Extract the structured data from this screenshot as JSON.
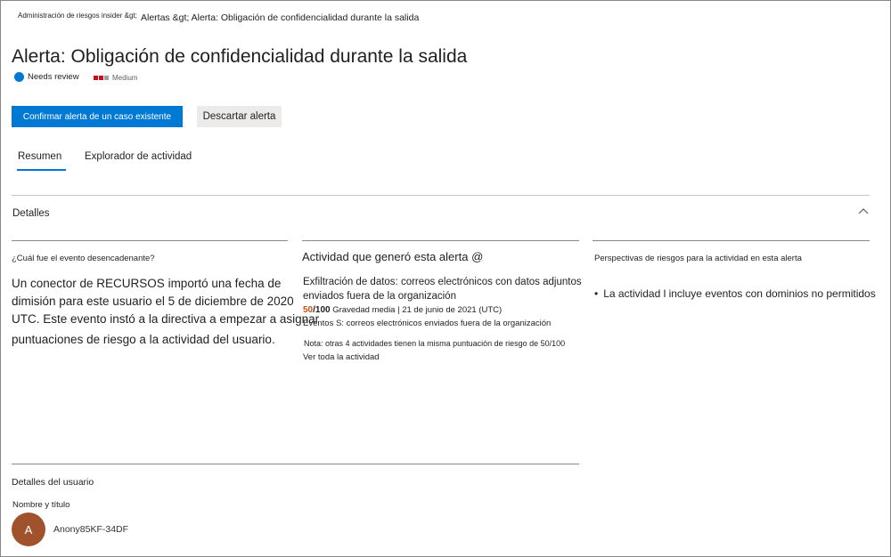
{
  "breadcrumb": {
    "root": "Administración de riesgos insider &gt;",
    "rest": "Alertas &gt; Alerta: Obligación de confidencialidad durante la salida"
  },
  "header": {
    "title": "Alerta: Obligación de confidencialidad durante la salida",
    "status": "Needs review",
    "severity": "Medium",
    "colors": {
      "accent": "#0078d4",
      "severity_red": "#c50f1f",
      "severity_gray": "#a19f9d"
    }
  },
  "actions": {
    "confirm_label": "Confirmar alerta de un caso existente",
    "dismiss_label": "Descartar alerta"
  },
  "tabs": [
    {
      "label": "Resumen",
      "active": true
    },
    {
      "label": "Explorador de actividad",
      "active": false
    }
  ],
  "details": {
    "label": "Detalles",
    "trigger": {
      "question": "¿Cuál fue el evento desencadenante?",
      "line1": "Un conector de RECURSOS importó una fecha de",
      "line2": "dimisión para este usuario el 5 de diciembre de 2020",
      "line3": "UTC. Este evento instó a la directiva a empezar a asignar",
      "line4": "puntuaciones de riesgo a la actividad del usuario."
    },
    "activity": {
      "heading": "Actividad que generó esta alerta @",
      "title_line1": "Exfiltración de datos: correos electrónicos con datos adjuntos",
      "title_line2": "enviados fuera de la organización",
      "score": "50",
      "score_max": "/100",
      "meta": "Gravedad media | 21 de junio de 2021 (UTC)",
      "events": "Eventos S: correos electrónicos enviados fuera de la organización",
      "note": "Nota: otras 4 actividades tienen la misma puntuación de riesgo de 50/100",
      "view_all": "Ver toda la actividad"
    },
    "insights": {
      "heading": "Perspectivas de riesgos para la actividad en esta alerta",
      "bullet": "La actividad l incluye eventos con dominios no permitidos"
    }
  },
  "user": {
    "section_label": "Detalles del usuario",
    "name_label": "Nombre y título",
    "avatar_initial": "A",
    "name": "Anony85KF-34DF"
  }
}
